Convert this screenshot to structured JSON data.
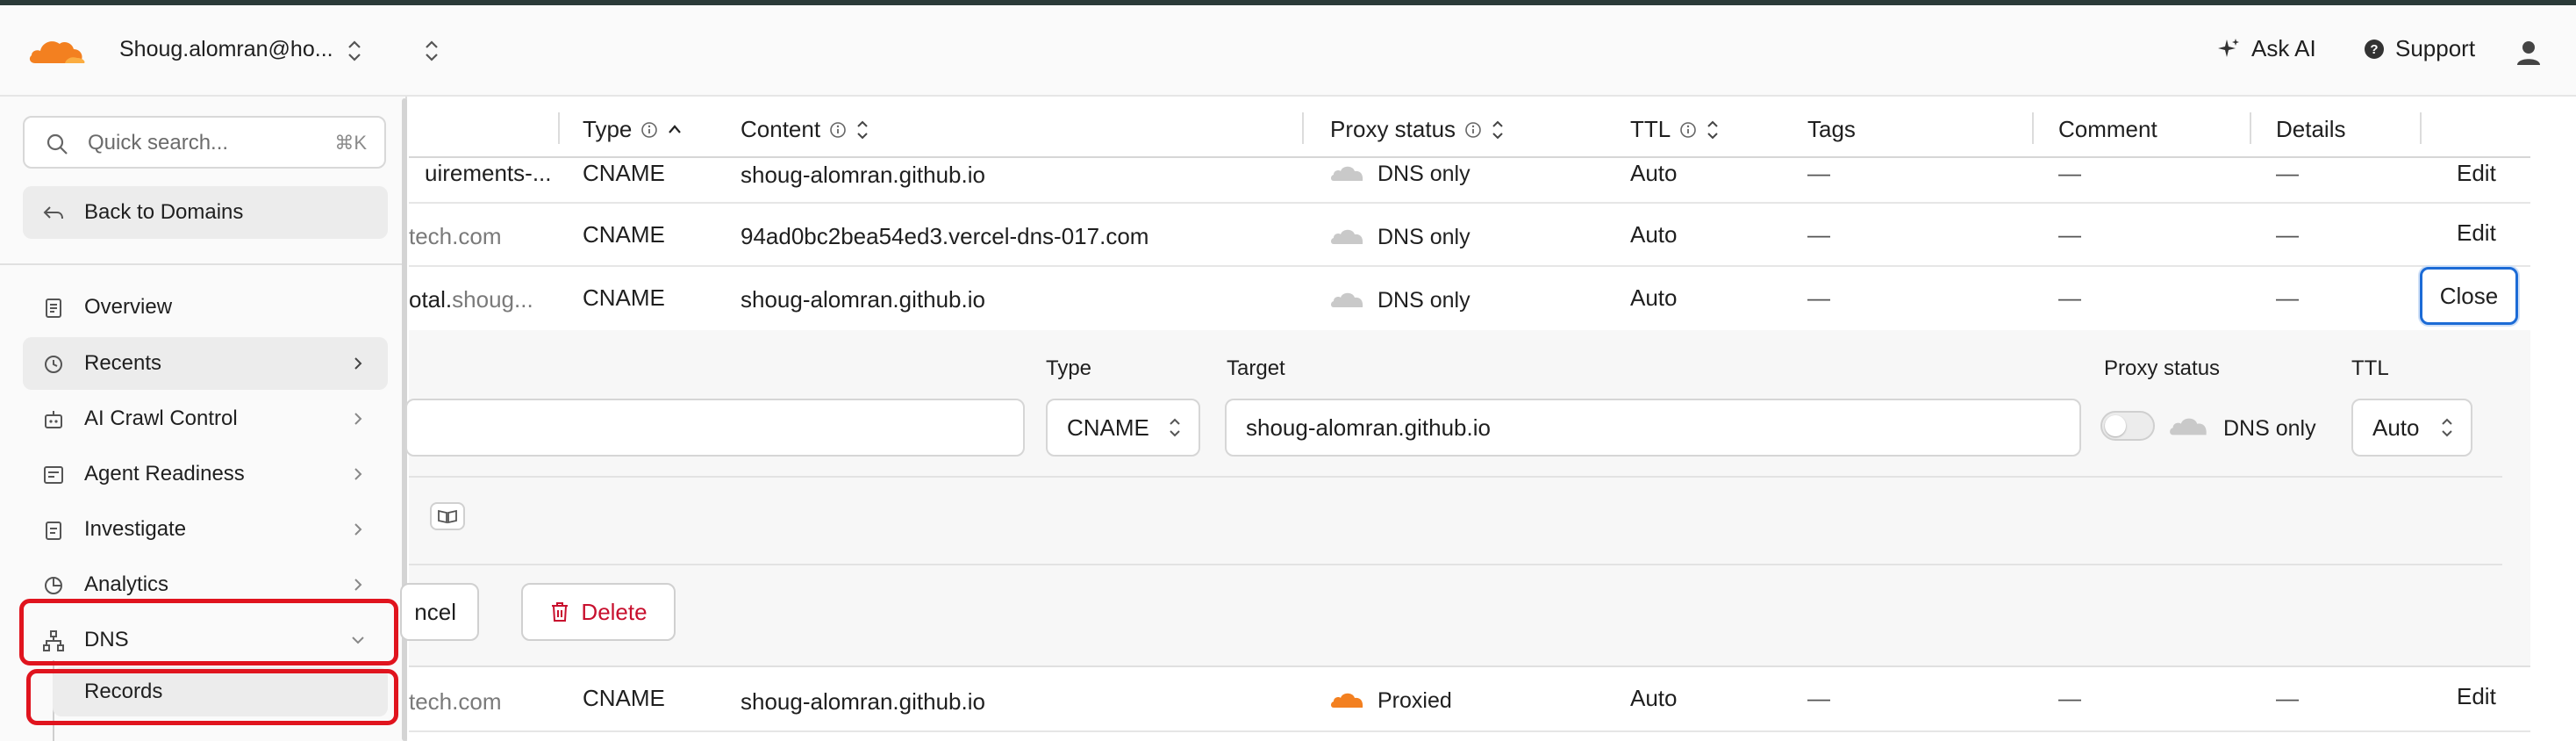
{
  "header": {
    "account": "Shoug.alomran@ho...",
    "ask_ai": "Ask AI",
    "support": "Support"
  },
  "sidebar": {
    "search_placeholder": "Quick search...",
    "search_shortcut": "⌘K",
    "back": "Back to Domains",
    "items": [
      {
        "label": "Overview",
        "icon": "document-icon"
      },
      {
        "label": "Recents",
        "icon": "history-icon"
      },
      {
        "label": "AI Crawl Control",
        "icon": "robot-icon"
      },
      {
        "label": "Agent Readiness",
        "icon": "checklist-icon"
      },
      {
        "label": "Investigate",
        "icon": "clipboard-icon"
      },
      {
        "label": "Analytics",
        "icon": "pie-chart-icon"
      },
      {
        "label": "DNS",
        "icon": "network-icon"
      }
    ],
    "sub_items": [
      {
        "label": "Records"
      }
    ]
  },
  "table": {
    "headers": {
      "type": "Type",
      "content": "Content",
      "proxy": "Proxy status",
      "ttl": "TTL",
      "tags": "Tags",
      "comment": "Comment",
      "details": "Details"
    },
    "rows": [
      {
        "name_a": "uirements-...",
        "name_b": "",
        "type": "CNAME",
        "content": "shoug-alomran.github.io",
        "proxy": "DNS only",
        "ttl": "Auto",
        "tags": "—",
        "comment": "—",
        "details": "—",
        "action": "Edit"
      },
      {
        "name_a": "",
        "name_b": "tech.com",
        "type": "CNAME",
        "content": "94ad0bc2bea54ed3.vercel-dns-017.com",
        "proxy": "DNS only",
        "ttl": "Auto",
        "tags": "—",
        "comment": "—",
        "details": "—",
        "action": "Edit"
      },
      {
        "name_a": "otal.",
        "name_b": "shoug...",
        "type": "CNAME",
        "content": "shoug-alomran.github.io",
        "proxy": "DNS only",
        "ttl": "Auto",
        "tags": "—",
        "comment": "—",
        "details": "—",
        "action": "Close"
      },
      {
        "name_a": "",
        "name_b": "tech.com",
        "type": "CNAME",
        "content": "shoug-alomran.github.io",
        "proxy": "Proxied",
        "ttl": "Auto",
        "tags": "—",
        "comment": "—",
        "details": "—",
        "action": "Edit"
      }
    ]
  },
  "edit_panel": {
    "type_label": "Type",
    "type_value": "CNAME",
    "target_label": "Target",
    "target_value": "shoug-alomran.github.io",
    "proxy_label": "Proxy status",
    "proxy_value": "DNS only",
    "proxy_enabled": false,
    "ttl_label": "TTL",
    "ttl_value": "Auto",
    "cancel": "ncel",
    "delete": "Delete"
  },
  "colors": {
    "brand_orange": "#f38020",
    "highlight_red": "#e0141e",
    "focus_blue": "#1c6bd6",
    "delete_red": "#c8102e"
  }
}
